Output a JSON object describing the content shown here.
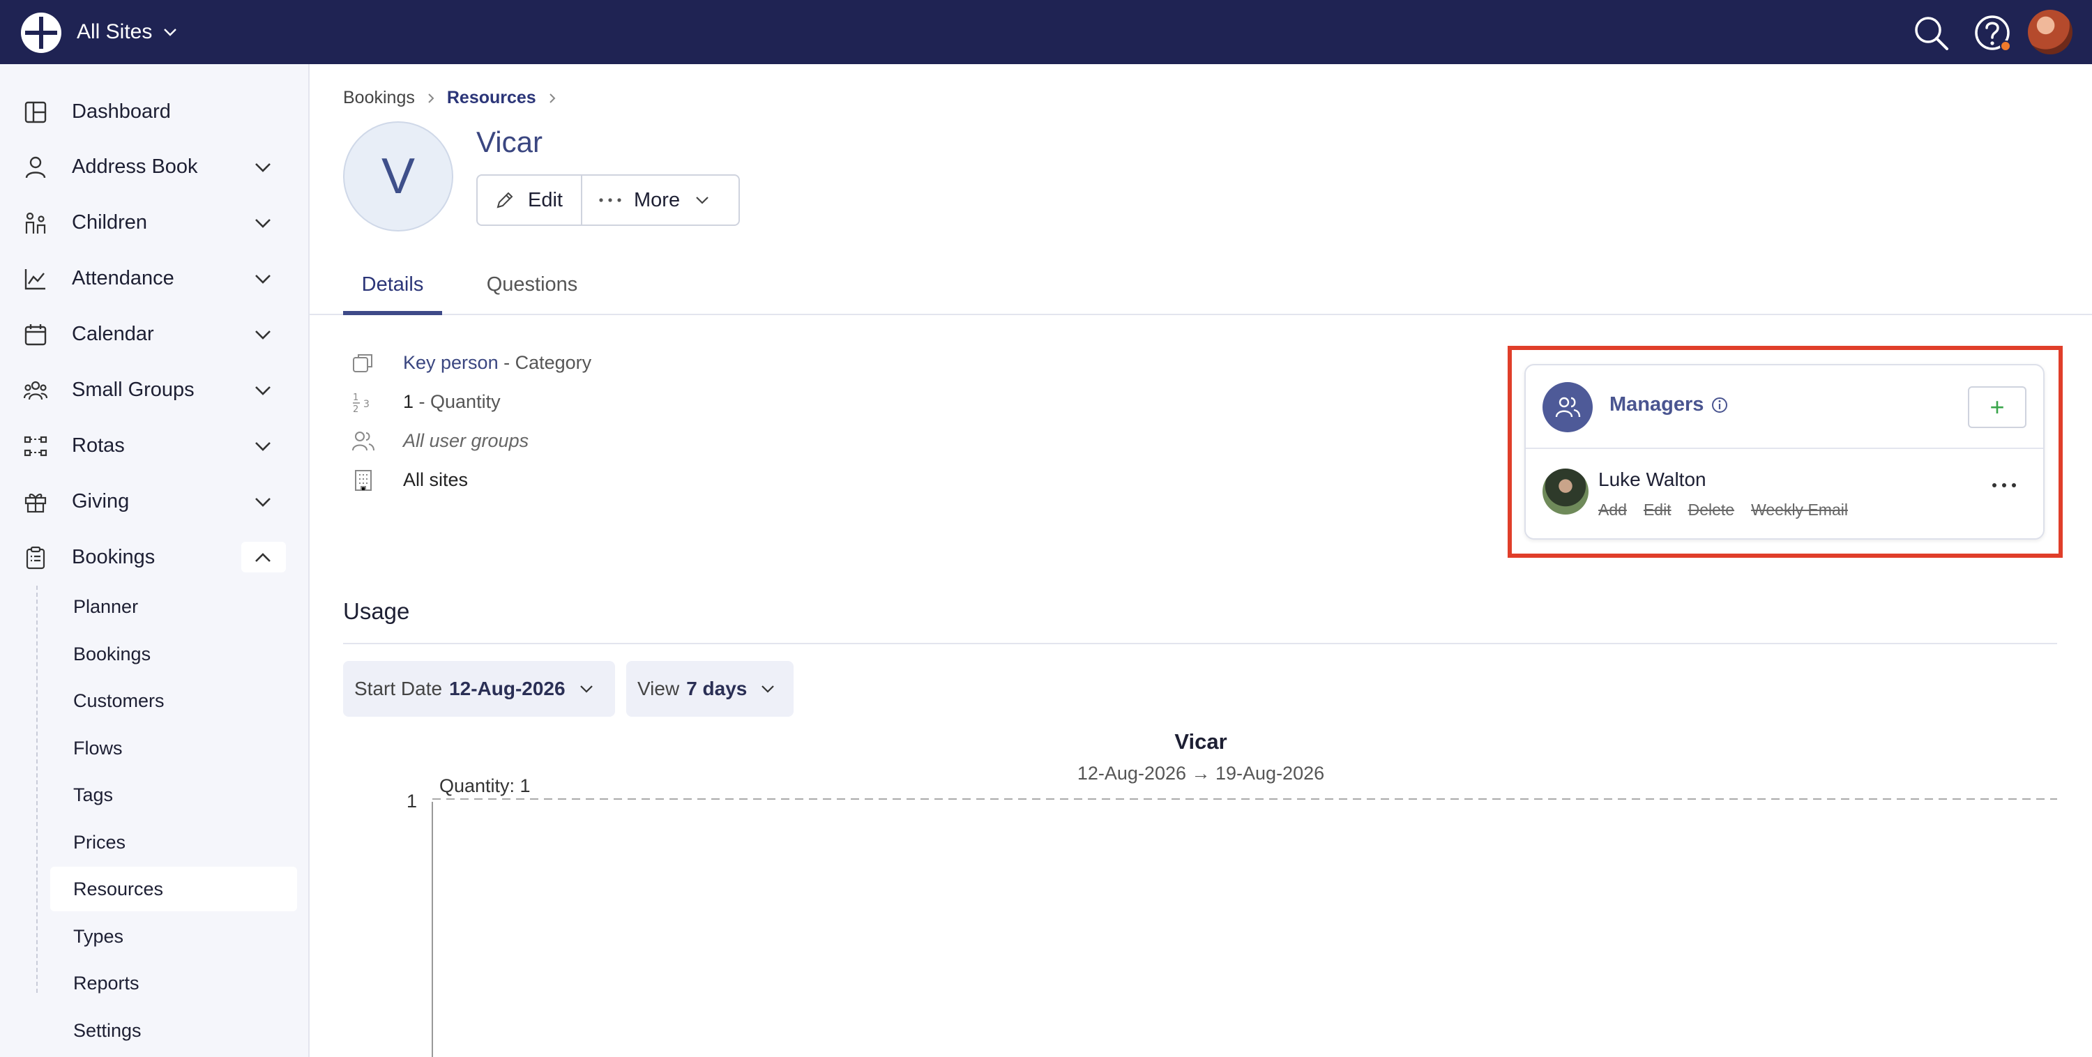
{
  "topbar": {
    "site_selector": "All Sites",
    "icons": [
      "logo-icon",
      "search-icon",
      "help-icon",
      "user-avatar"
    ]
  },
  "sidebar": {
    "items": [
      {
        "label": "Dashboard",
        "icon": "dashboard-icon",
        "expandable": false
      },
      {
        "label": "Address Book",
        "icon": "person-icon",
        "expandable": true
      },
      {
        "label": "Children",
        "icon": "children-icon",
        "expandable": true
      },
      {
        "label": "Attendance",
        "icon": "chart-icon",
        "expandable": true
      },
      {
        "label": "Calendar",
        "icon": "calendar-icon",
        "expandable": true
      },
      {
        "label": "Small Groups",
        "icon": "groups-icon",
        "expandable": true
      },
      {
        "label": "Rotas",
        "icon": "rotas-icon",
        "expandable": true
      },
      {
        "label": "Giving",
        "icon": "gift-icon",
        "expandable": true
      },
      {
        "label": "Bookings",
        "icon": "clipboard-icon",
        "expandable": true,
        "expanded": true
      }
    ],
    "bookings_subitems": [
      "Planner",
      "Bookings",
      "Customers",
      "Flows",
      "Tags",
      "Prices",
      "Resources",
      "Types",
      "Reports",
      "Settings"
    ],
    "active_subitem": "Resources"
  },
  "breadcrumb": {
    "items": [
      "Bookings",
      "Resources"
    ]
  },
  "resource": {
    "initial": "V",
    "title": "Vicar",
    "edit_label": "Edit",
    "more_label": "More"
  },
  "tabs": [
    {
      "label": "Details",
      "active": true
    },
    {
      "label": "Questions",
      "active": false
    }
  ],
  "details": {
    "category_value": "Key person",
    "category_suffix": " - Category",
    "quantity_value": "1",
    "quantity_suffix": " - Quantity",
    "user_groups": "All user groups",
    "sites": "All sites"
  },
  "managers": {
    "title": "Managers",
    "add_label": "+",
    "person": {
      "name": "Luke Walton",
      "permissions": [
        "Add",
        "Edit",
        "Delete",
        "Weekly Email"
      ]
    }
  },
  "usage": {
    "title": "Usage",
    "start_date_label": "Start Date",
    "start_date_value": "12-Aug-2026",
    "view_label": "View",
    "view_value": "7 days"
  },
  "chart_data": {
    "type": "line",
    "title": "Vicar",
    "subtitle": "12-Aug-2026 → 19-Aug-2026",
    "y_ticks": [
      "1"
    ],
    "reference_line": {
      "label": "Quantity: 1",
      "value": 1
    },
    "series": []
  },
  "colors": {
    "topbar": "#1f2353",
    "accent": "#3e4a88",
    "highlight": "#e03e2a",
    "add": "#3aa54b"
  }
}
